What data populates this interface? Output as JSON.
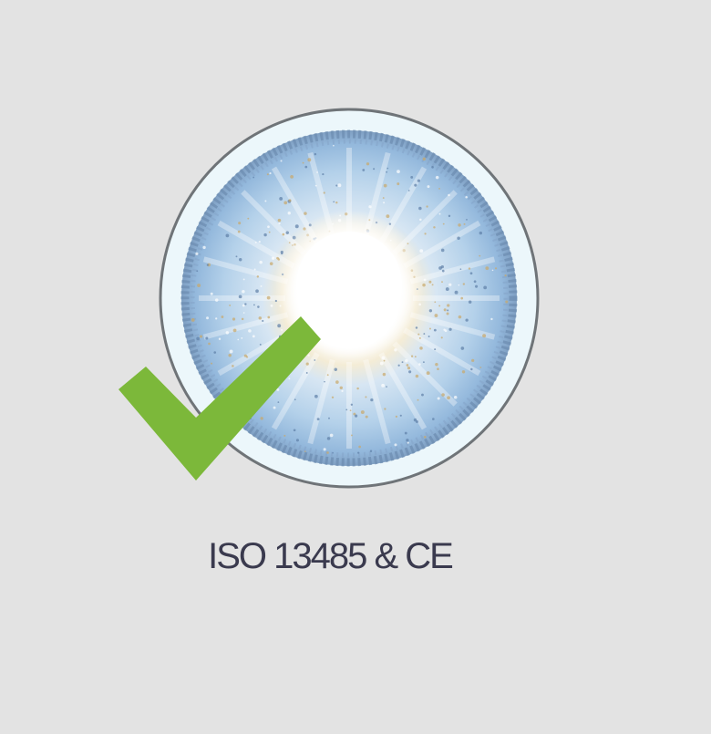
{
  "badge": {
    "caption": "ISO 13485 & CE",
    "icon": "contact-lens-icon",
    "check_icon": "checkmark-icon"
  },
  "colors": {
    "background": "#e3e3e3",
    "lens_blue": "#a8c9e6",
    "lens_rim": "#6f8aa6",
    "check_green": "#7cb83a",
    "caption_text": "#3a3a4e"
  }
}
